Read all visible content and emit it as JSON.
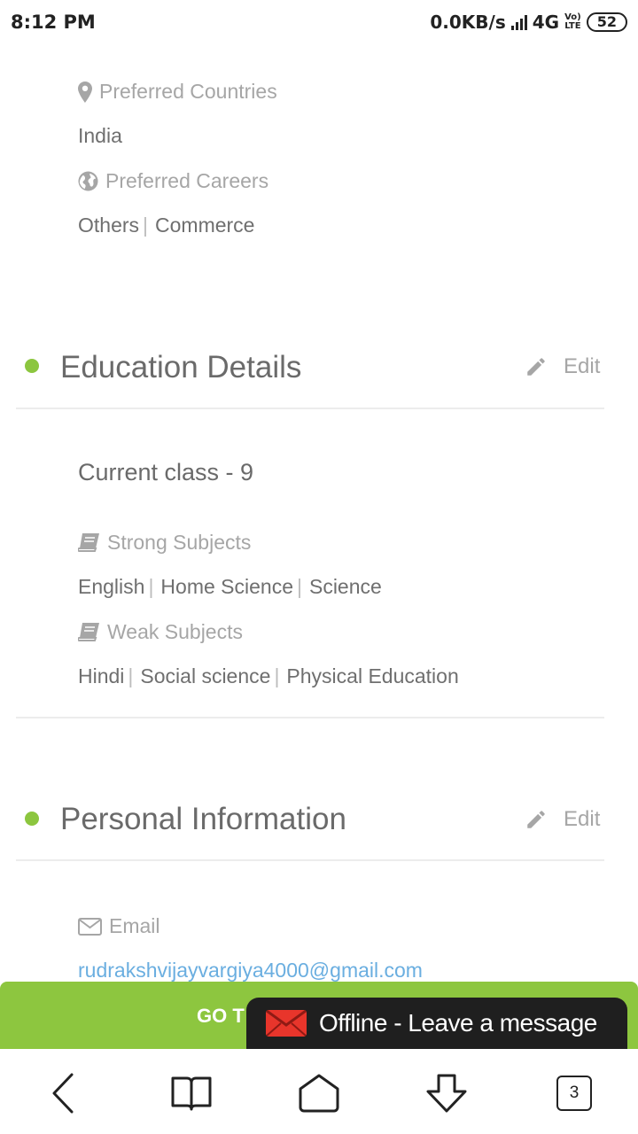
{
  "status_bar": {
    "time": "8:12 PM",
    "network_speed": "0.0KB/s",
    "network_type": "4G",
    "volte_line1": "Vo)",
    "volte_line2": "LTE",
    "battery": "52"
  },
  "preferences": {
    "countries_label": "Preferred Countries",
    "countries_value": "India",
    "careers_label": "Preferred Careers",
    "careers": [
      "Others",
      "Commerce"
    ]
  },
  "education": {
    "title": "Education Details",
    "edit_label": "Edit",
    "current_class": "Current class - 9",
    "strong_label": "Strong Subjects",
    "strong_subjects": [
      "English",
      "Home Science",
      "Science"
    ],
    "weak_label": "Weak Subjects",
    "weak_subjects": [
      "Hindi",
      "Social science",
      "Physical Education"
    ]
  },
  "personal": {
    "title": "Personal Information",
    "edit_label": "Edit",
    "email_label": "Email",
    "email_value": "rudrakshvijayvargiya4000@gmail.com"
  },
  "cta": {
    "label": "GO T"
  },
  "chat_widget": {
    "label": "Offline - Leave a message"
  },
  "nav": {
    "tab_count": "3"
  },
  "colors": {
    "accent_green": "#8dc63f",
    "link_blue": "#6aaee0",
    "chat_dark": "#1f1f1f"
  },
  "icons": [
    "map-marker-icon",
    "globe-icon",
    "pencil-icon",
    "book-icon",
    "envelope-icon",
    "chat-mail-icon",
    "back-icon",
    "bookmarks-icon",
    "home-icon",
    "download-icon",
    "tabs-icon"
  ]
}
